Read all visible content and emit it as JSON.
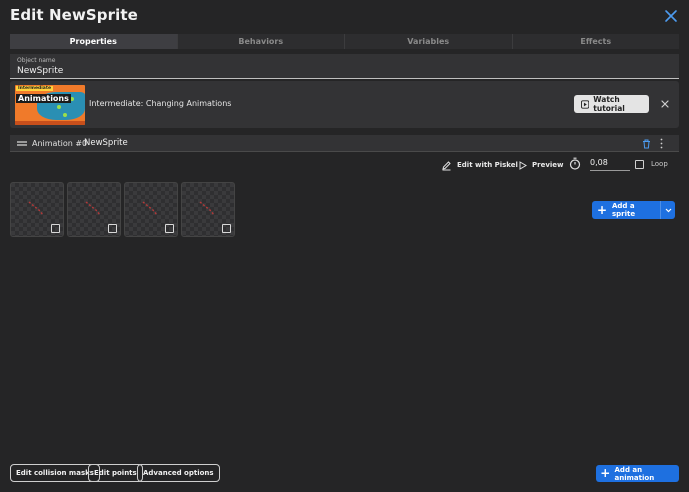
{
  "dialog": {
    "title": "Edit NewSprite",
    "close_icon": "close-icon"
  },
  "tabs": [
    {
      "label": "Properties",
      "active": true
    },
    {
      "label": "Behaviors",
      "active": false
    },
    {
      "label": "Variables",
      "active": false
    },
    {
      "label": "Effects",
      "active": false
    }
  ],
  "object_name": {
    "label": "Object name",
    "value": "NewSprite"
  },
  "tutorial": {
    "thumb_tag": "Intermediate",
    "thumb_title": "Animations",
    "title": "Intermediate: Changing Animations",
    "watch_label": "Watch tutorial"
  },
  "animation": {
    "label": "Animation #0",
    "name": "NewSprite"
  },
  "toolbar": {
    "edit_with_piskel": "Edit with Piskel",
    "preview": "Preview",
    "speed_value": "0,08",
    "loop_label": "Loop"
  },
  "frames": [
    {
      "selected": false
    },
    {
      "selected": false
    },
    {
      "selected": false
    },
    {
      "selected": false
    }
  ],
  "buttons": {
    "add_sprite": "Add a sprite",
    "edit_collision_masks": "Edit collision masks",
    "edit_points": "Edit points",
    "advanced_options": "Advanced options",
    "add_animation": "Add an animation"
  },
  "colors": {
    "accent": "#1e70e0",
    "background": "#252526",
    "panel": "#333335"
  }
}
